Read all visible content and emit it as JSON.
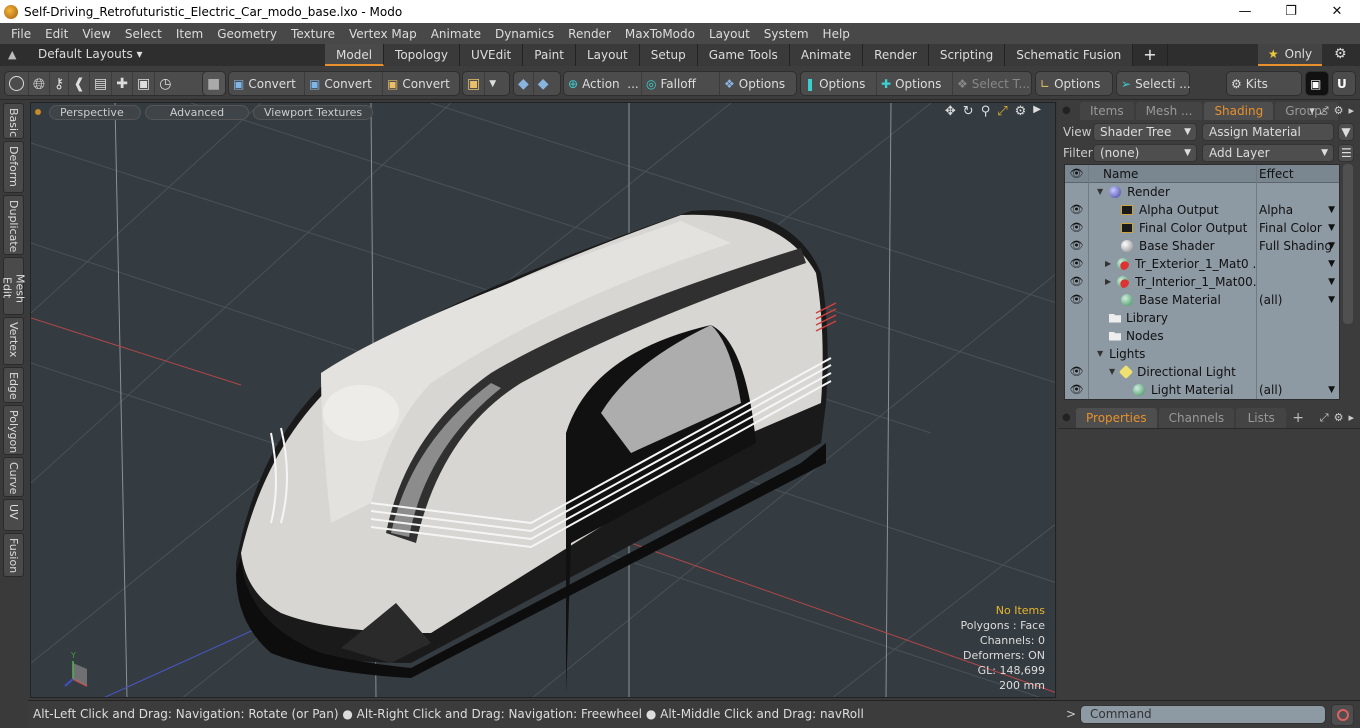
{
  "window": {
    "title": "Self-Driving_Retrofuturistic_Electric_Car_modo_base.lxo - Modo",
    "controls": [
      "minimize",
      "maximize",
      "close"
    ]
  },
  "menu": [
    "File",
    "Edit",
    "View",
    "Select",
    "Item",
    "Geometry",
    "Texture",
    "Vertex Map",
    "Animate",
    "Dynamics",
    "Render",
    "MaxToModo",
    "Layout",
    "System",
    "Help"
  ],
  "layoutbar": {
    "default_layouts": "Default Layouts ▾",
    "tabs": [
      "Model",
      "Topology",
      "UVEdit",
      "Paint",
      "Layout",
      "Setup",
      "Game Tools",
      "Animate",
      "Render",
      "Scripting",
      "Schematic Fusion"
    ],
    "active_tab": "Model",
    "plus": "+",
    "only_label": "Only"
  },
  "toolbar": {
    "convert1": "Convert",
    "convert2": "Convert",
    "convert3": "Convert",
    "action": "Action",
    "action_more": "...",
    "falloff": "Falloff",
    "options1": "Options",
    "options2": "Options",
    "options3": "Options",
    "select_t": "Select T...",
    "options4": "Options",
    "selecti": "Selecti ...",
    "kits": "Kits"
  },
  "left_tabs": [
    "Basic",
    "Deform",
    "Duplicate",
    "Mesh Edit",
    "Vertex",
    "Edge",
    "Polygon",
    "Curve",
    "UV",
    "Fusion"
  ],
  "viewport": {
    "perspective": "Perspective",
    "advanced": "Advanced",
    "textures": "Viewport Textures",
    "info": {
      "selection": "No Items",
      "polygons": "Polygons : Face",
      "channels": "Channels: 0",
      "deformers": "Deformers: ON",
      "gl": "GL: 148,699",
      "scale": "200 mm"
    },
    "colors": {
      "background": "#343b41",
      "x_axis": "#c04848",
      "z_axis": "#4a58c8",
      "body": "#d8d6d2",
      "trim": "#1a1a1a"
    }
  },
  "status": {
    "hint": "Alt-Left Click and Drag: Navigation: Rotate (or Pan) ● Alt-Right Click and Drag: Navigation: Freewheel ● Alt-Middle Click and Drag: navRoll"
  },
  "shading_panel": {
    "tabs": [
      "Items",
      "Mesh ...",
      "Shading",
      "Groups"
    ],
    "active_tab": "Shading",
    "view_label": "View",
    "view_value": "Shader Tree",
    "assign_material": "Assign Material",
    "filter_label": "Filter",
    "filter_value": "(none)",
    "add_layer": "Add Layer",
    "columns": {
      "name": "Name",
      "effect": "Effect"
    },
    "rows": [
      {
        "name": "Render",
        "effect": "",
        "eye": false,
        "icon": "render-sphere"
      },
      {
        "name": "Alpha Output",
        "effect": "Alpha",
        "eye": true,
        "icon": "output"
      },
      {
        "name": "Final Color Output",
        "effect": "Final Color",
        "eye": true,
        "icon": "output"
      },
      {
        "name": "Base Shader",
        "effect": "Full Shading",
        "eye": true,
        "icon": "shader"
      },
      {
        "name": "Tr_Exterior_1_Mat0 ...",
        "effect": "",
        "eye": true,
        "icon": "material-group"
      },
      {
        "name": "Tr_Interior_1_Mat00...",
        "effect": "",
        "eye": true,
        "icon": "material-group"
      },
      {
        "name": "Base Material",
        "effect": "(all)",
        "eye": true,
        "icon": "material"
      },
      {
        "name": "Library",
        "effect": "",
        "eye": false,
        "icon": "folder"
      },
      {
        "name": "Nodes",
        "effect": "",
        "eye": false,
        "icon": "folder"
      },
      {
        "name": "Lights",
        "effect": "",
        "eye": false,
        "icon": "none"
      },
      {
        "name": "Directional Light",
        "effect": "",
        "eye": true,
        "icon": "light"
      },
      {
        "name": "Light Material",
        "effect": "(all)",
        "eye": true,
        "icon": "material"
      }
    ]
  },
  "properties_panel": {
    "tabs": [
      "Properties",
      "Channels",
      "Lists"
    ],
    "active_tab": "Properties",
    "plus": "+"
  },
  "command": {
    "prompt": ">",
    "placeholder": "Command"
  },
  "accent_color": "#e8902c"
}
